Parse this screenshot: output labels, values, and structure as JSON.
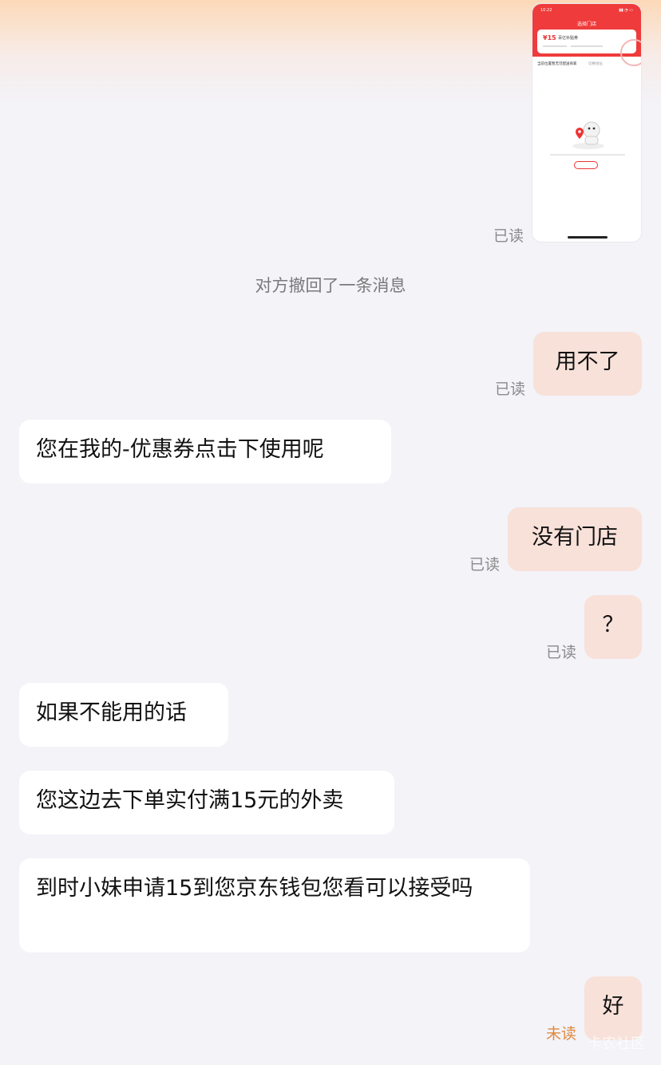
{
  "thumbnail": {
    "status_time": "10:22",
    "title": "选择门店",
    "coupon_price": "¥15",
    "coupon_name": "百亿补贴券",
    "location_text": "当前位置暂无可配送商家",
    "location_action": "切换地址",
    "colors": {
      "header": "#ef3b3b"
    }
  },
  "messages": [
    {
      "side": "me",
      "type": "image",
      "status": "已读"
    },
    {
      "side": "system",
      "text": "对方撤回了一条消息"
    },
    {
      "side": "me",
      "text": "用不了",
      "status": "已读"
    },
    {
      "side": "them",
      "text": "您在我的-优惠券点击下使用呢"
    },
    {
      "side": "me",
      "text": "没有门店",
      "status": "已读"
    },
    {
      "side": "me",
      "text": "？",
      "status": "已读"
    },
    {
      "side": "them",
      "text": "如果不能用的话"
    },
    {
      "side": "them",
      "text": "您这边去下单实付满15元的外卖"
    },
    {
      "side": "them",
      "text": "到时小妹申请15到您京东钱包您看可以接受吗"
    },
    {
      "side": "me",
      "text": "好",
      "status": "未读"
    }
  ],
  "watermark": "卡农社区",
  "colors": {
    "my_bubble": "#f8e1d9",
    "their_bubble": "#ffffff",
    "background": "#f3f3f8",
    "read_status": "#8b8b8b",
    "unread_status": "#e0893f"
  }
}
